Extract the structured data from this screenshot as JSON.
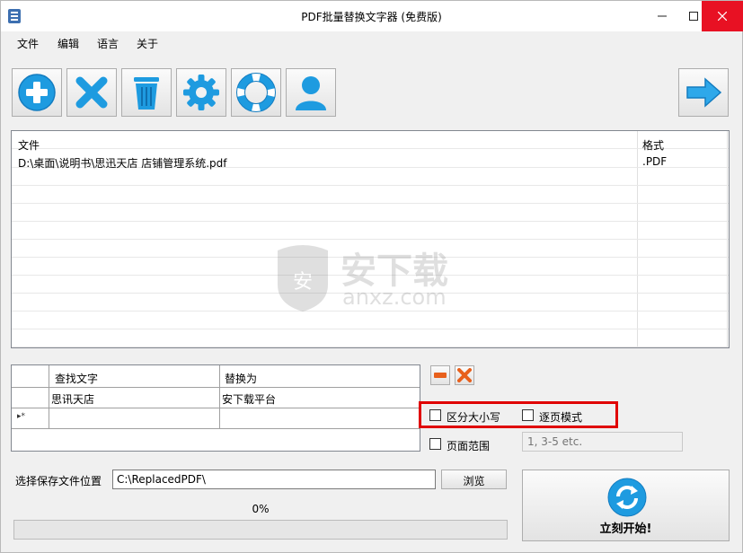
{
  "window": {
    "title": "PDF批量替换文字器 (免费版)"
  },
  "menu": [
    "文件",
    "编辑",
    "语言",
    "关于"
  ],
  "toolbar": {
    "buttons": [
      "add-icon",
      "remove-icon",
      "trash-icon",
      "settings-icon",
      "help-lifebuoy-icon",
      "user-icon"
    ],
    "next": "arrow-right-icon"
  },
  "file_list": {
    "headers": {
      "file": "文件",
      "format": "格式"
    },
    "rows": [
      {
        "file": "D:\\桌面\\说明书\\思迅天店 店铺管理系统.pdf",
        "format": ".PDF"
      }
    ]
  },
  "watermark": {
    "text": "安下载",
    "subtext": "anxz.com"
  },
  "replace_grid": {
    "headers": {
      "find": "查找文字",
      "replace": "替换为"
    },
    "rows": [
      {
        "find": "思讯天店",
        "replace": "安下载平台"
      }
    ],
    "new_row_marker": "▸*"
  },
  "options": {
    "case_sensitive": {
      "label": "区分大小写",
      "checked": false
    },
    "page_mode": {
      "label": "逐页模式",
      "checked": false
    },
    "page_range": {
      "label": "页面范围",
      "checked": false,
      "placeholder": "1, 3-5 etc."
    }
  },
  "save": {
    "label": "选择保存文件位置",
    "path": "C:\\ReplacedPDF\\",
    "browse": "浏览"
  },
  "progress": {
    "text": "0%",
    "value": 0
  },
  "start": {
    "label": "立刻开始!"
  },
  "colors": {
    "accent_blue": "#1e9be0",
    "highlight_red": "#e00000",
    "delete_orange": "#e8601c"
  }
}
